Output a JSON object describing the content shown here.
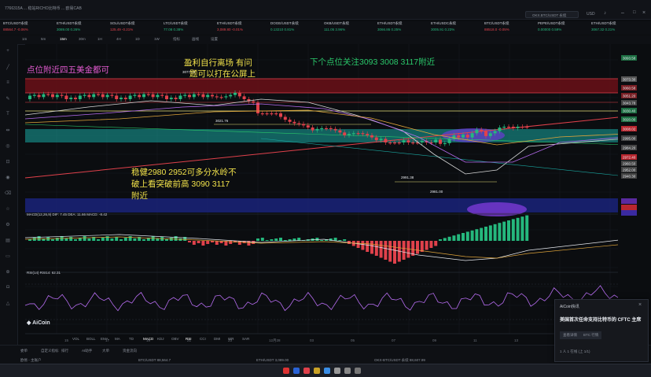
{
  "window": {
    "title": "7766315A ... 稳站RICHO比特币 ... 欧易CAB",
    "search_placeholder": "OKX.BTC/USDT 永续",
    "currency": "USD"
  },
  "tickers": [
    {
      "name": "BTC/USDT永续",
      "price": "88564.7",
      "change": "-0.06%",
      "dir": "down"
    },
    {
      "name": "ETH/USDT永续",
      "price": "3089.00",
      "change": "0.26%",
      "dir": "up"
    },
    {
      "name": "SOL/USDT永续",
      "price": "125.49",
      "change": "-0.21%",
      "dir": "down"
    },
    {
      "name": "LTC/USDT永续",
      "price": "77.08",
      "change": "0.38%",
      "dir": "up"
    },
    {
      "name": "ETH/USDT永续",
      "price": "3,089.80",
      "change": "-0.01%",
      "dir": "down"
    },
    {
      "name": "DOGE/USDT永续",
      "price": "0.13210",
      "change": "0.81%",
      "dir": "up"
    },
    {
      "name": "OKB/USDT永续",
      "price": "111.05",
      "change": "3.96%",
      "dir": "up"
    },
    {
      "name": "ETH/USDT永续",
      "price": "3066.86",
      "change": "0.25%",
      "dir": "up"
    },
    {
      "name": "ETH/USDC永续",
      "price": "3005.91",
      "change": "0.23%",
      "dir": "up"
    },
    {
      "name": "BTC/USDT永续",
      "price": "88518.0",
      "change": "-0.05%",
      "dir": "down"
    },
    {
      "name": "PEPE/USDT永续",
      "price": "0.00000",
      "change": "0.59%",
      "dir": "up"
    },
    {
      "name": "ETH/USDT永续",
      "price": "3067.32",
      "change": "0.21%",
      "dir": "up"
    }
  ],
  "toolbar": [
    "1m",
    "5m",
    "15m",
    "30m",
    "1H",
    "4H",
    "1D",
    "1W",
    "指标",
    "画线",
    "设置"
  ],
  "overlays": {
    "o1": "点位附近四五美金都可",
    "o2_line1": "盈利自行离场 有问",
    "o2_line2": "题可以打在公屏上",
    "o3": "下个点位关注3093 3008 3117附近",
    "o4_line1": "稳健2980 2952可多分水岭不",
    "o4_line2": "破上看突破前高 3090 3117",
    "o4_line3": "附近"
  },
  "chart_labels": {
    "high": "3077.99",
    "low": "2981.00",
    "mid": "3021.76",
    "support": "2991.38"
  },
  "right_axis": [
    "3093.58",
    "3073.30",
    "3060.58",
    "3051.20",
    "3043.78",
    "3030.40",
    "3020.00",
    "3008.02",
    "2995.00",
    "2984.20",
    "2972.40",
    "2960.50",
    "2952.00",
    "2940.30"
  ],
  "indicator_labels": {
    "macd": "MACD(12,26,9) DIF: 7.45 DEA: 11.66 MACD: -8.42",
    "rsi": "RSI(14) RSI14: 62.31"
  },
  "indicator_tabs": [
    "VOL",
    "BOLL",
    "EMA",
    "MA",
    "TD",
    "MACD",
    "KDJ",
    "OBV",
    "RSI",
    "CCI",
    "DMI",
    "WR",
    "SAR"
  ],
  "bottom": {
    "tabs": [
      "委单",
      "自定义指标",
      "排行",
      "AI助手",
      "大单",
      "资金流向"
    ],
    "status": [
      "欧易 - 主账户",
      "BTC/USDT 88,564.7",
      "ETH/USDT 3,089.00",
      "OKX-BTC/USDT 永续 88,607.99"
    ]
  },
  "popup": {
    "title": "AiCoin快讯",
    "headline": "美国首次任命支持比特币的 CFTC 主席",
    "btn1": "查看详情",
    "btn2": "BTC 行情",
    "footer": "1 人 1 在线 (上 1/1)"
  },
  "colors": {
    "up": "#25b87d",
    "down": "#e0414b",
    "bg": "#0b0d10"
  }
}
